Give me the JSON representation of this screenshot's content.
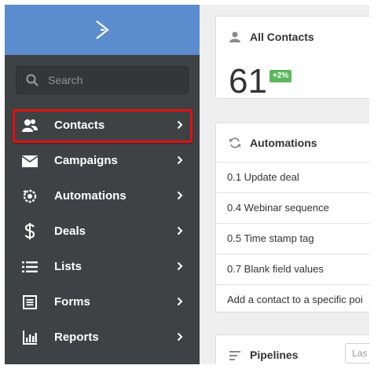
{
  "sidebar": {
    "logo_icon": "chevron-right-logo-icon",
    "search": {
      "placeholder": "Search",
      "icon": "search-icon"
    },
    "items": [
      {
        "label": "Contacts",
        "icon": "contacts-icon",
        "highlighted": true
      },
      {
        "label": "Campaigns",
        "icon": "envelope-icon"
      },
      {
        "label": "Automations",
        "icon": "automation-gear-icon"
      },
      {
        "label": "Deals",
        "icon": "dollar-icon"
      },
      {
        "label": "Lists",
        "icon": "list-icon"
      },
      {
        "label": "Forms",
        "icon": "form-icon"
      },
      {
        "label": "Reports",
        "icon": "bar-chart-icon"
      }
    ]
  },
  "main": {
    "contacts_card": {
      "title": "All Contacts",
      "count": "61",
      "change": "+2%"
    },
    "automations_card": {
      "title": "Automations",
      "items": [
        "0.1 Update deal",
        "0.4 Webinar sequence",
        "0.5 Time stamp tag",
        "0.7 Blank field values",
        "Add a contact to a specific poi"
      ]
    },
    "pipelines_card": {
      "title": "Pipelines",
      "filter_value": "Las"
    }
  },
  "colors": {
    "sidebar_bg": "#3f4244",
    "logo_bar": "#5b8ccd",
    "highlight_border": "#e30f0f",
    "badge_green": "#5cb85c"
  }
}
